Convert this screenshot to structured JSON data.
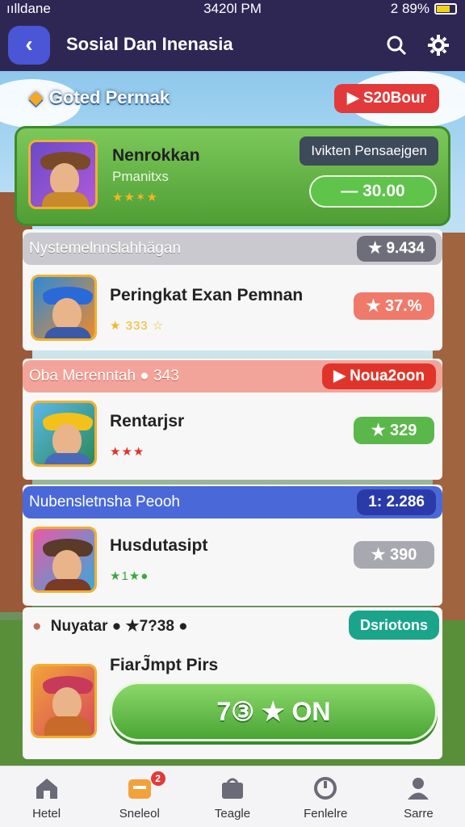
{
  "status_bar": {
    "carrier": "ıılldane",
    "time": "3420l PM",
    "battery": "2 89%"
  },
  "header": {
    "title": "Sosial Dan Inenasia",
    "back_label": "‹"
  },
  "section": {
    "title": "Goted Permak",
    "badge": "S20Bour"
  },
  "featured": {
    "name": "Nenrokkan",
    "subtitle": "Pmanitxs",
    "tag": "Ivikten Pensaejgen",
    "price": "— 30.00"
  },
  "groups": [
    {
      "title": "Nystemelnnslahhägan",
      "pill": "9.434",
      "name": "Peringkat Exan Pemnan",
      "score": "37.%",
      "stars": "★ 333 ☆"
    },
    {
      "title": "Oba Merenntah ● 343",
      "pill": "▶ Noua2oon",
      "name": "Rentarjsr",
      "score": "★ 329",
      "stars": "★★★"
    },
    {
      "title": "Nubensletnsha Peooh",
      "pill": "1: 2.286",
      "name": "Husdutasipt",
      "score": "★ 390",
      "stars": "★1★●"
    }
  ],
  "last": {
    "label": "Nuyatar ● ★7?38 ●",
    "action": "Dsriotons",
    "name": "FiarJ̃mpt Pirs",
    "cta": "7③ ★ ON"
  },
  "nav": [
    {
      "label": "Hetel"
    },
    {
      "label": "Sneleol",
      "badge": "2"
    },
    {
      "label": "Teagle"
    },
    {
      "label": "Fenlelre"
    },
    {
      "label": "Sarre"
    }
  ]
}
